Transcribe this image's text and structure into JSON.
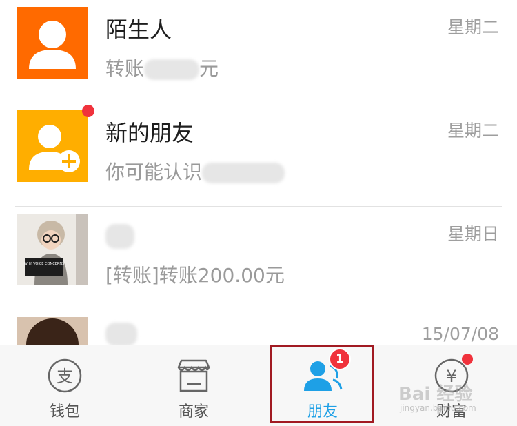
{
  "conversations": [
    {
      "title": "陌生人",
      "preview_prefix": "转账",
      "preview_suffix": "元",
      "time": "星期二",
      "avatar_icon": "person-icon",
      "avatar_color": "#ff6a00"
    },
    {
      "title": "新的朋友",
      "preview_prefix": "你可能认识",
      "preview_suffix": "",
      "time": "星期二",
      "avatar_icon": "add-person-icon",
      "avatar_color": "#ffae00",
      "unread_dot": true
    },
    {
      "title": "",
      "preview_prefix": "[转账]转账200.00元",
      "preview_suffix": "",
      "time": "星期日",
      "avatar_icon": "photo-avatar"
    },
    {
      "title": "",
      "preview_prefix": "",
      "preview_suffix": "",
      "time": "15/07/08",
      "avatar_icon": "photo-avatar"
    }
  ],
  "avatar_sign_text": "WHY VOICE CONCERNS",
  "tabbar": {
    "tabs": [
      {
        "label": "钱包",
        "icon": "alipay-icon"
      },
      {
        "label": "商家",
        "icon": "store-icon"
      },
      {
        "label": "朋友",
        "icon": "friends-icon",
        "selected": true,
        "badge": "1"
      },
      {
        "label": "财富",
        "icon": "yuan-icon",
        "dot": true
      }
    ]
  },
  "colors": {
    "selected_tab": "#1ea0e6",
    "badge": "#f0323c",
    "highlight_box": "#a11a22"
  },
  "watermark": {
    "main": "Bai 经验",
    "sub": "jingyan.baidu.com"
  }
}
